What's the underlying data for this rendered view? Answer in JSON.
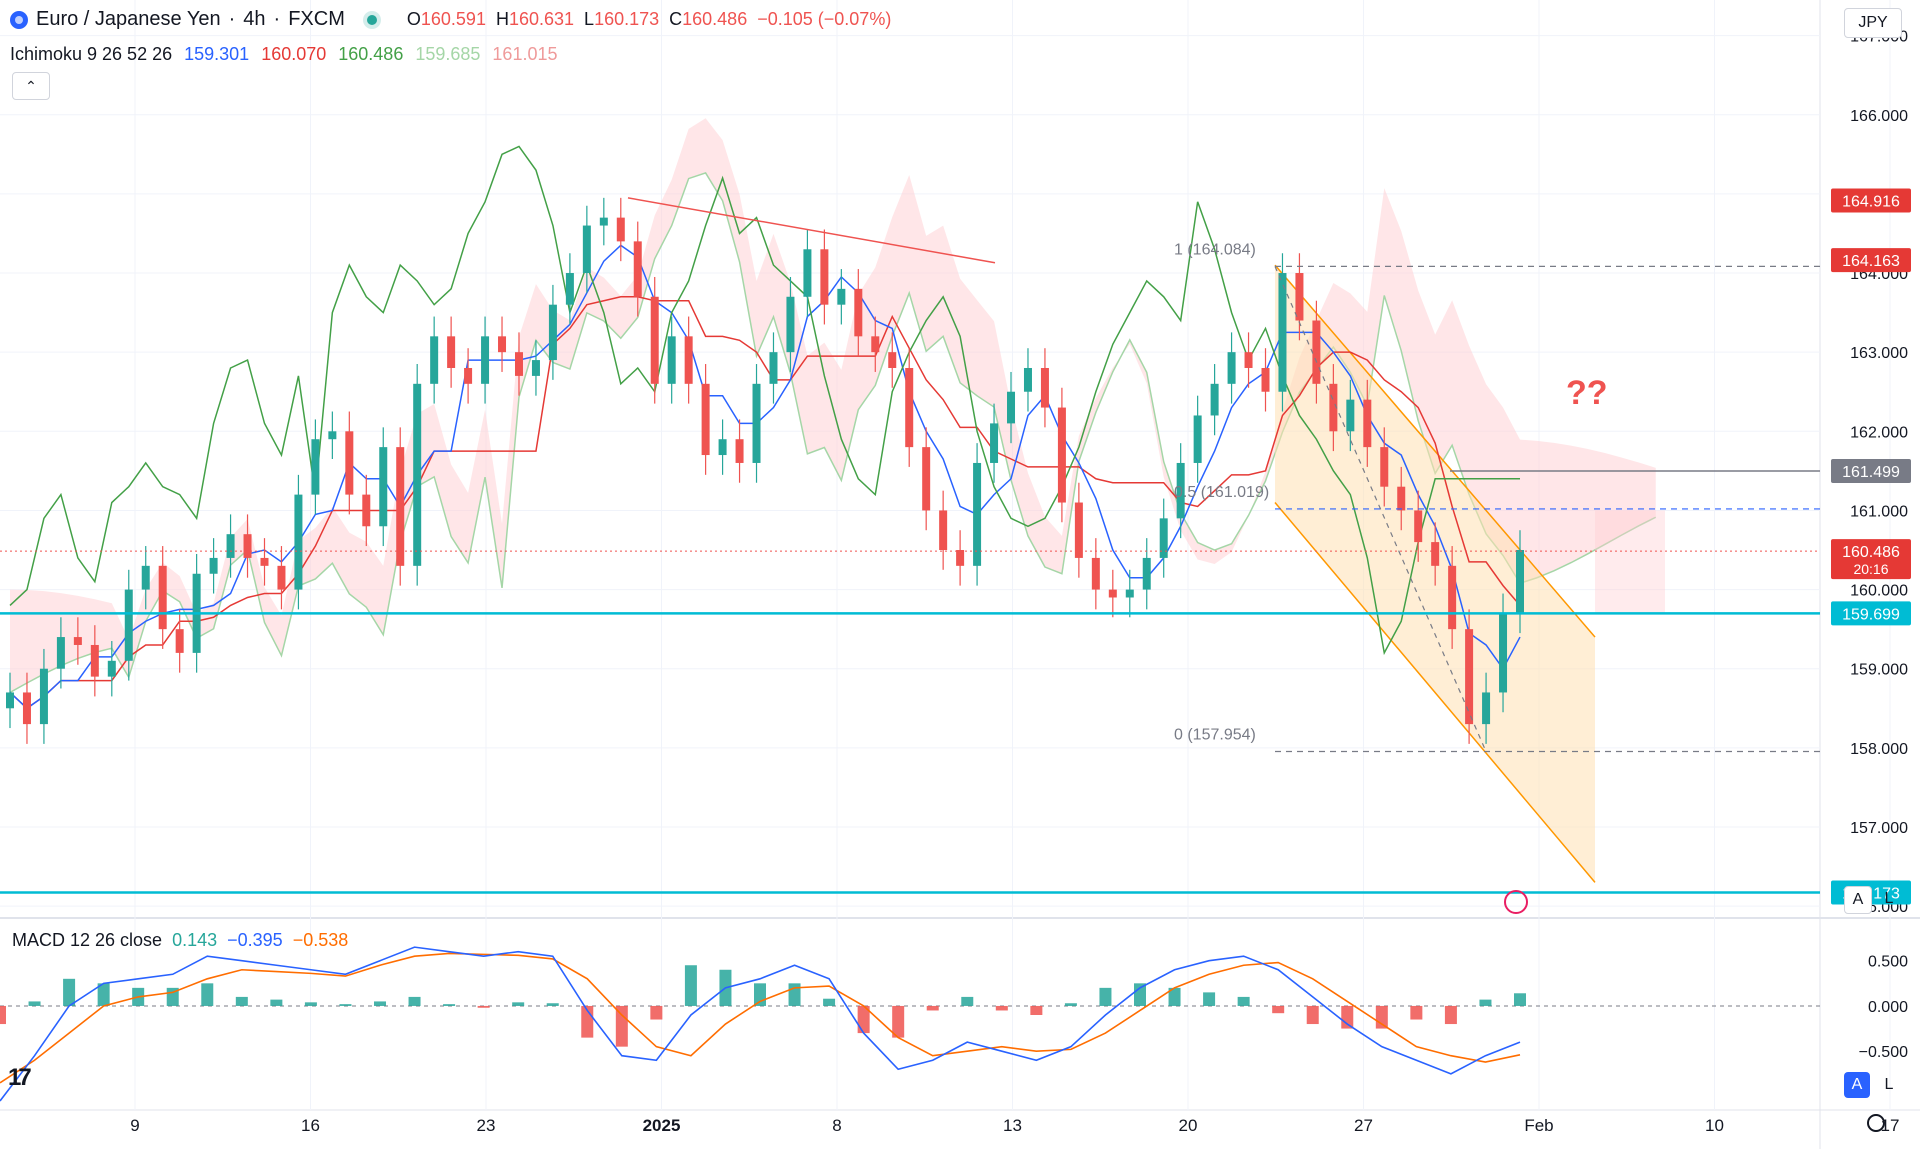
{
  "header": {
    "symbol_name": "Euro / Japanese Yen",
    "timeframe": "4h",
    "exchange": "FXCM",
    "open_label": "O",
    "open": "160.591",
    "high_label": "H",
    "high": "160.631",
    "low_label": "L",
    "low": "160.173",
    "close_label": "C",
    "close": "160.486",
    "change": "−0.105 (−0.07%)"
  },
  "ichimoku": {
    "label": "Ichimoku 9 26 52 26",
    "v1": "159.301",
    "v2": "160.070",
    "v3": "160.486",
    "v4": "159.685",
    "v5": "161.015",
    "colors": {
      "tenkan": "#2962ff",
      "kijun": "#e53935",
      "chikou": "#43a047",
      "spanA": "#a5d6a7",
      "spanB": "#ef9a9a",
      "cloud_bull": "#c8e6c9",
      "cloud_bear": "#ffcdd2"
    }
  },
  "currency": "JPY",
  "price_axis": {
    "ticks": [
      "167.000",
      "166.000",
      "165.000",
      "164.000",
      "163.000",
      "162.000",
      "161.000",
      "160.000",
      "159.000",
      "158.000",
      "157.000",
      "156.000"
    ],
    "min": 155.85,
    "max": 167.45,
    "badges": [
      {
        "value": "164.916",
        "color": "#e53935"
      },
      {
        "value": "164.163",
        "color": "#e53935"
      },
      {
        "value": "161.499",
        "color": "#787b86"
      },
      {
        "value": "160.486",
        "sub": "20:16",
        "color": "#e53935"
      },
      {
        "value": "159.699",
        "color": "#00bcd4"
      },
      {
        "value": "156.173",
        "color": "#00bcd4"
      }
    ]
  },
  "time_axis": {
    "labels": [
      "9",
      "16",
      "23",
      "2025",
      "8",
      "13",
      "20",
      "27",
      "Feb",
      "10",
      "17"
    ]
  },
  "fib": {
    "level_1": "1 (164.084)",
    "level_05": "0.5 (161.019)",
    "level_0": "0 (157.954)"
  },
  "annotation_text": "??",
  "macd": {
    "label": "MACD 12 26 close",
    "hist": "0.143",
    "macd": "−0.395",
    "signal": "−0.538",
    "ticks": [
      "0.500",
      "0.000",
      "−0.500"
    ],
    "colors": {
      "macd": "#2962ff",
      "signal": "#ff6d00",
      "hist_up": "#26a69a",
      "hist_down": "#ef5350"
    }
  },
  "scale_buttons": {
    "auto": "A",
    "log": "L"
  },
  "chart_data": {
    "type": "candlestick",
    "title": "Euro / Japanese Yen · 4h · FXCM",
    "y_range": [
      155.85,
      167.45
    ],
    "horizontal_levels": [
      {
        "value": 159.699,
        "color": "#00bcd4"
      },
      {
        "value": 156.173,
        "color": "#00bcd4"
      },
      {
        "value": 161.499,
        "color": "#787b86"
      }
    ],
    "fib_retracement": {
      "high": 164.084,
      "mid": 161.019,
      "low": 157.954
    },
    "descending_channel": true,
    "close_series": [
      158.7,
      158.3,
      159.0,
      159.4,
      159.3,
      158.9,
      159.1,
      160.0,
      160.3,
      159.5,
      159.2,
      160.2,
      160.4,
      160.7,
      160.4,
      160.3,
      160.0,
      161.2,
      161.9,
      162.0,
      161.2,
      160.8,
      161.8,
      160.3,
      162.6,
      163.2,
      162.8,
      162.6,
      163.2,
      163.0,
      162.7,
      162.9,
      163.6,
      164.0,
      164.6,
      164.7,
      164.4,
      163.7,
      162.6,
      163.2,
      162.6,
      161.7,
      161.9,
      161.6,
      162.6,
      163.0,
      163.7,
      164.3,
      163.6,
      163.8,
      163.2,
      163.0,
      162.8,
      161.8,
      161.0,
      160.5,
      160.3,
      161.6,
      162.1,
      162.5,
      162.8,
      162.3,
      161.1,
      160.4,
      160.0,
      159.9,
      160.0,
      160.4,
      160.9,
      161.6,
      162.2,
      162.6,
      163.0,
      162.8,
      162.5,
      164.0,
      163.4,
      162.6,
      162.0,
      162.4,
      161.8,
      161.3,
      161.0,
      160.6,
      160.3,
      159.5,
      158.3,
      158.7,
      159.7,
      160.5
    ],
    "series": [
      {
        "name": "MACD",
        "values": [
          -1.05,
          -0.55,
          0.0,
          0.25,
          0.3,
          0.35,
          0.55,
          0.5,
          0.45,
          0.4,
          0.35,
          0.5,
          0.65,
          0.6,
          0.55,
          0.6,
          0.55,
          -0.05,
          -0.55,
          -0.6,
          -0.1,
          0.2,
          0.3,
          0.45,
          0.3,
          -0.3,
          -0.7,
          -0.6,
          -0.4,
          -0.5,
          -0.6,
          -0.45,
          -0.1,
          0.2,
          0.4,
          0.5,
          0.55,
          0.4,
          0.1,
          -0.2,
          -0.45,
          -0.6,
          -0.75,
          -0.55,
          -0.4
        ]
      },
      {
        "name": "Signal",
        "values": [
          -0.85,
          -0.6,
          -0.3,
          0.0,
          0.1,
          0.15,
          0.3,
          0.4,
          0.38,
          0.36,
          0.33,
          0.45,
          0.55,
          0.58,
          0.57,
          0.56,
          0.52,
          0.3,
          -0.1,
          -0.45,
          -0.55,
          -0.2,
          0.05,
          0.2,
          0.22,
          0.0,
          -0.35,
          -0.55,
          -0.5,
          -0.45,
          -0.5,
          -0.48,
          -0.3,
          -0.05,
          0.2,
          0.35,
          0.45,
          0.48,
          0.3,
          0.05,
          -0.2,
          -0.45,
          -0.55,
          -0.62,
          -0.54
        ]
      }
    ]
  }
}
